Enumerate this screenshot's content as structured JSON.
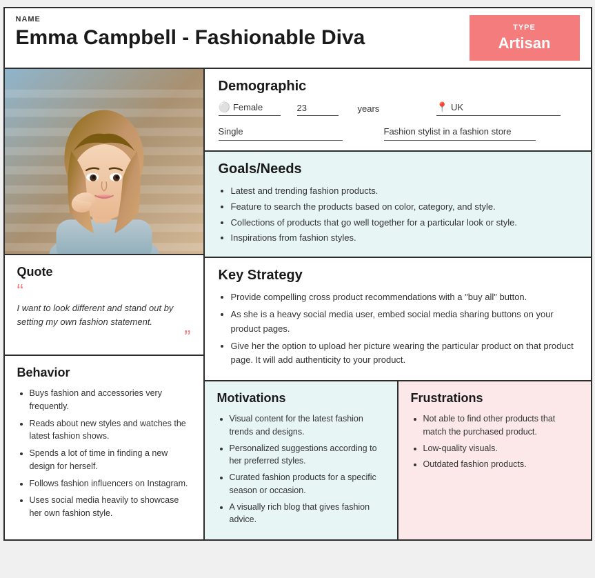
{
  "header": {
    "name_label": "NAME",
    "name_value": "Emma Campbell - Fashionable Diva",
    "type_label": "TYPE",
    "type_value": "Artisan"
  },
  "demographic": {
    "section_title": "Demographic",
    "gender": "Female",
    "age": "23",
    "age_unit": "years",
    "location": "UK",
    "relationship": "Single",
    "occupation": "Fashion stylist in a fashion store"
  },
  "quote": {
    "section_title": "Quote",
    "text": "I want to look different and stand out by setting my own fashion statement."
  },
  "behavior": {
    "section_title": "Behavior",
    "items": [
      "Buys fashion and accessories very frequently.",
      "Reads about new styles and watches the latest fashion shows.",
      "Spends a lot of time in finding a new design for herself.",
      "Follows fashion influencers on Instagram.",
      "Uses social media heavily to showcase her own fashion style."
    ]
  },
  "goals": {
    "section_title": "Goals/Needs",
    "items": [
      "Latest and trending fashion products.",
      "Feature to search the products based on color, category, and style.",
      "Collections of products that go well together for a particular look or style.",
      "Inspirations from fashion styles."
    ]
  },
  "strategy": {
    "section_title": "Key Strategy",
    "items": [
      "Provide compelling cross product recommendations with a \"buy all\" button.",
      "As she is a heavy social media user, embed social media sharing buttons on your product pages.",
      "Give her the option to upload her picture wearing the particular product on that product page. It will add authenticity to your product."
    ]
  },
  "motivations": {
    "section_title": "Motivations",
    "items": [
      "Visual content for the latest fashion trends and designs.",
      "Personalized suggestions according to her preferred styles.",
      "Curated fashion products for a specific season or occasion.",
      "A visually rich blog that gives fashion advice."
    ]
  },
  "frustrations": {
    "section_title": "Frustrations",
    "items": [
      "Not able to find other products that match the purchased product.",
      "Low-quality visuals.",
      "Outdated fashion products."
    ]
  }
}
